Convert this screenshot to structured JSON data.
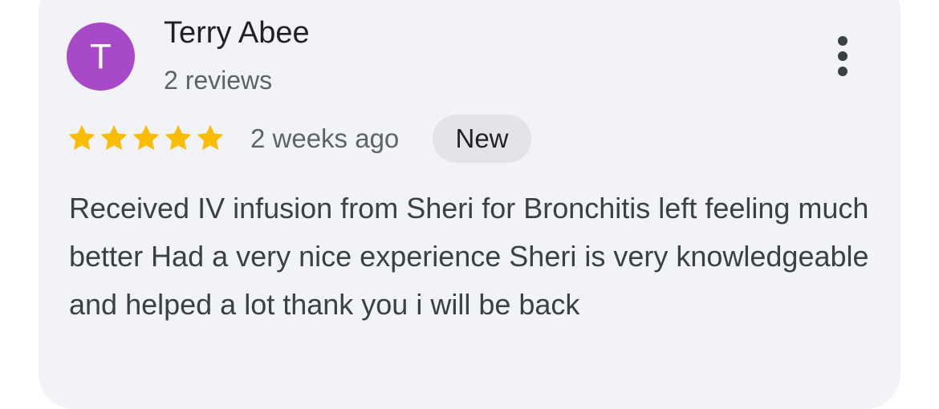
{
  "review": {
    "avatar_initial": "T",
    "author_name": "Terry Abee",
    "author_meta": "2 reviews",
    "rating": 5,
    "rating_max": 5,
    "time_ago": "2 weeks ago",
    "badge": "New",
    "text": "Received IV infusion from Sheri for Bronchitis left feeling much better Had a very nice experience Sheri is very knowledgeable and helped a lot thank you i will be back"
  },
  "icons": {
    "more": "more-vert-icon",
    "star": "star-icon"
  },
  "colors": {
    "card_bg": "#f2f3f6",
    "avatar_bg": "#a84ac8",
    "star": "#fbbc04",
    "badge_bg": "#e3e4e7",
    "primary_text": "#202124",
    "secondary_text": "#5f6368",
    "body_text": "#3c4043"
  }
}
